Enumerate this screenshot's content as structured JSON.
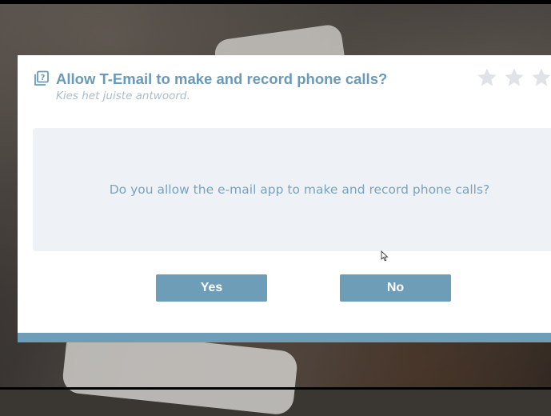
{
  "dialog": {
    "title": "Allow T-Email to make and record phone calls?",
    "subtitle": "Kies het juiste antwoord.",
    "question": "Do you allow the e-mail app to make and record phone calls?",
    "rating": {
      "stars_total": 3,
      "stars_filled": 0
    }
  },
  "buttons": {
    "yes_label": "Yes",
    "no_label": "No"
  },
  "icons": {
    "title_icon": "question-copy-icon",
    "rating_icon": "star-icon"
  },
  "colors": {
    "accent": "#6e9db7",
    "title": "#6a9ab8",
    "subtitle": "#a9bdc9",
    "panel": "#eef2f6",
    "star_empty": "#dfe3e8"
  }
}
